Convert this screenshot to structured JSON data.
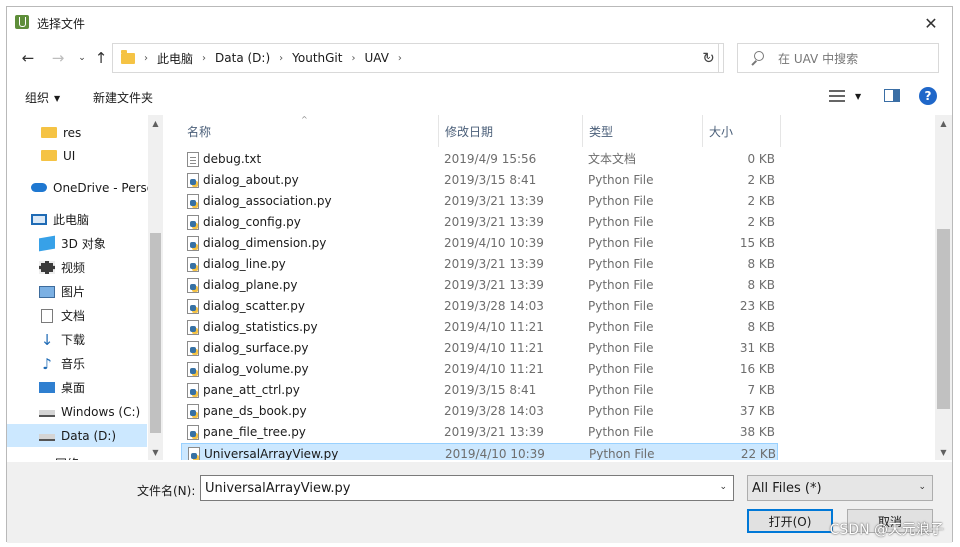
{
  "window": {
    "title": "选择文件",
    "close": "✕"
  },
  "nav": {
    "back": "←",
    "forward": "→",
    "recent": "⌄",
    "up": "↑",
    "breadcrumb": [
      "此电脑",
      "Data (D:)",
      "YouthGit",
      "UAV"
    ],
    "refresh": "↻",
    "search_placeholder": "在 UAV 中搜索"
  },
  "toolbar": {
    "organize": "组织",
    "new_folder": "新建文件夹",
    "help": "?"
  },
  "sidebar": {
    "items": [
      {
        "label": "res",
        "icon": "folder-icon"
      },
      {
        "label": "UI",
        "icon": "folder-icon"
      },
      {
        "label": "OneDrive - Perso",
        "icon": "cloud-icon"
      },
      {
        "label": "此电脑",
        "icon": "computer-icon"
      },
      {
        "label": "3D 对象",
        "icon": "3d-objects-icon"
      },
      {
        "label": "视频",
        "icon": "video-icon"
      },
      {
        "label": "图片",
        "icon": "pictures-icon"
      },
      {
        "label": "文档",
        "icon": "documents-icon"
      },
      {
        "label": "下载",
        "icon": "downloads-icon"
      },
      {
        "label": "音乐",
        "icon": "music-icon"
      },
      {
        "label": "桌面",
        "icon": "desktop-icon"
      },
      {
        "label": "Windows (C:)",
        "icon": "drive-icon"
      },
      {
        "label": "Data (D:)",
        "icon": "drive-icon"
      },
      {
        "label": "网络",
        "icon": "network-icon"
      }
    ],
    "selected_index": 12
  },
  "columns": {
    "name": "名称",
    "date": "修改日期",
    "type": "类型",
    "size": "大小"
  },
  "files": [
    {
      "name": "debug.txt",
      "date": "2019/4/9 15:56",
      "type": "文本文档",
      "size": "0 KB",
      "kind": "txt"
    },
    {
      "name": "dialog_about.py",
      "date": "2019/3/15 8:41",
      "type": "Python File",
      "size": "2 KB",
      "kind": "py"
    },
    {
      "name": "dialog_association.py",
      "date": "2019/3/21 13:39",
      "type": "Python File",
      "size": "2 KB",
      "kind": "py"
    },
    {
      "name": "dialog_config.py",
      "date": "2019/3/21 13:39",
      "type": "Python File",
      "size": "2 KB",
      "kind": "py"
    },
    {
      "name": "dialog_dimension.py",
      "date": "2019/4/10 10:39",
      "type": "Python File",
      "size": "15 KB",
      "kind": "py"
    },
    {
      "name": "dialog_line.py",
      "date": "2019/3/21 13:39",
      "type": "Python File",
      "size": "8 KB",
      "kind": "py"
    },
    {
      "name": "dialog_plane.py",
      "date": "2019/3/21 13:39",
      "type": "Python File",
      "size": "8 KB",
      "kind": "py"
    },
    {
      "name": "dialog_scatter.py",
      "date": "2019/3/28 14:03",
      "type": "Python File",
      "size": "23 KB",
      "kind": "py"
    },
    {
      "name": "dialog_statistics.py",
      "date": "2019/4/10 11:21",
      "type": "Python File",
      "size": "8 KB",
      "kind": "py"
    },
    {
      "name": "dialog_surface.py",
      "date": "2019/4/10 11:21",
      "type": "Python File",
      "size": "31 KB",
      "kind": "py"
    },
    {
      "name": "dialog_volume.py",
      "date": "2019/4/10 11:21",
      "type": "Python File",
      "size": "16 KB",
      "kind": "py"
    },
    {
      "name": "pane_att_ctrl.py",
      "date": "2019/3/15 8:41",
      "type": "Python File",
      "size": "7 KB",
      "kind": "py"
    },
    {
      "name": "pane_ds_book.py",
      "date": "2019/3/28 14:03",
      "type": "Python File",
      "size": "37 KB",
      "kind": "py"
    },
    {
      "name": "pane_file_tree.py",
      "date": "2019/3/21 13:39",
      "type": "Python File",
      "size": "38 KB",
      "kind": "py"
    },
    {
      "name": "UniversalArrayView.py",
      "date": "2019/4/10 10:39",
      "type": "Python File",
      "size": "22 KB",
      "kind": "py"
    }
  ],
  "selected_file_index": 14,
  "bottom": {
    "filename_label": "文件名(N):",
    "filename_value": "UniversalArrayView.py",
    "filter_value": "All Files (*)",
    "open_button": "打开(O)",
    "cancel_button": "取消"
  },
  "watermark": "CSDN @天元浪子",
  "colors": {
    "selection": "#cce8ff",
    "selection_border": "#99d1ff",
    "accent": "#0078d7"
  }
}
